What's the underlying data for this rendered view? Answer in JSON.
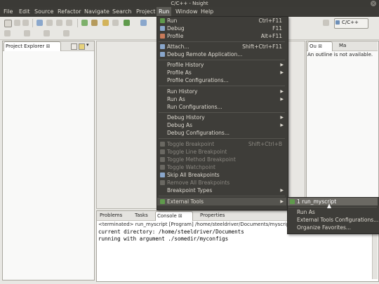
{
  "window": {
    "title": "C/C++ - Nsight"
  },
  "menubar": {
    "items": [
      "File",
      "Edit",
      "Source",
      "Refactor",
      "Navigate",
      "Search",
      "Project",
      "Run",
      "Window",
      "Help"
    ],
    "active": "Run"
  },
  "toolbar": {
    "perspective_label": "C/C++"
  },
  "project_explorer": {
    "tab_label": "Project Explorer"
  },
  "outline": {
    "tab_label": "Ou",
    "tab2_label": "Ma",
    "message": "An outline is not available."
  },
  "console": {
    "tabs": [
      "Problems",
      "Tasks",
      "Console",
      "Properties"
    ],
    "status": "<terminated> run_myscript [Program] /home/steeldriver/Documents/myscript",
    "lines": [
      "current directory: /home/steeldriver/Documents",
      "running with argument ./somedir/myconfigs"
    ]
  },
  "run_menu": {
    "items": [
      {
        "label": "Run",
        "accel": "Ctrl+F11"
      },
      {
        "label": "Debug",
        "accel": "F11"
      },
      {
        "label": "Profile",
        "accel": "Alt+F11"
      },
      {
        "label": "Attach...",
        "accel": "Shift+Ctrl+F11"
      },
      {
        "label": "Debug Remote Application..."
      },
      {
        "label": "Profile History"
      },
      {
        "label": "Profile As"
      },
      {
        "label": "Profile Configurations..."
      },
      {
        "label": "Run History"
      },
      {
        "label": "Run As"
      },
      {
        "label": "Run Configurations..."
      },
      {
        "label": "Debug History"
      },
      {
        "label": "Debug As"
      },
      {
        "label": "Debug Configurations..."
      },
      {
        "label": "Toggle Breakpoint",
        "accel": "Shift+Ctrl+B"
      },
      {
        "label": "Toggle Line Breakpoint"
      },
      {
        "label": "Toggle Method Breakpoint"
      },
      {
        "label": "Toggle Watchpoint"
      },
      {
        "label": "Skip All Breakpoints"
      },
      {
        "label": "Remove All Breakpoints"
      },
      {
        "label": "Breakpoint Types"
      },
      {
        "label": "External Tools"
      }
    ]
  },
  "external_tools_submenu": {
    "items": [
      "1 run_myscript",
      "Run As",
      "External Tools Configurations...",
      "Organize Favorites..."
    ]
  },
  "colors": {
    "menu_bg": "#3e3d39",
    "menu_text": "#dfdbd2",
    "disabled_text": "#8a8780",
    "highlight": "#55544f"
  }
}
